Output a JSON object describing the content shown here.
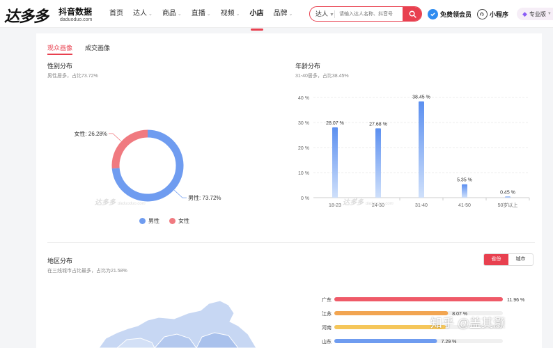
{
  "header": {
    "logo_text": "达多多",
    "logo_subtitle": "抖音数据",
    "logo_domain": "daduoduo.com",
    "nav": [
      {
        "label": "首页",
        "caret": false,
        "active": false
      },
      {
        "label": "达人",
        "caret": true,
        "active": false
      },
      {
        "label": "商品",
        "caret": true,
        "active": false
      },
      {
        "label": "直播",
        "caret": true,
        "active": false
      },
      {
        "label": "视频",
        "caret": true,
        "active": false
      },
      {
        "label": "小店",
        "caret": false,
        "active": true
      },
      {
        "label": "品牌",
        "caret": true,
        "active": false
      }
    ],
    "search": {
      "type_label": "达人",
      "placeholder": "请输入达人名称、抖音号"
    },
    "free_member_label": "免费领会员",
    "mini_program_label": "小程序",
    "pro_label": "专业版",
    "brand_color": "#e8404f"
  },
  "subtabs": {
    "audience": "观众画像",
    "deal": "成交画像"
  },
  "gender": {
    "title": "性别分布",
    "subtitle": "男性居多，占比73.72%",
    "legend_male": "男性",
    "legend_female": "女性"
  },
  "age": {
    "title": "年龄分布",
    "subtitle": "31-40居多，占比38.45%"
  },
  "region": {
    "title": "地区分布",
    "subtitle": "在三线城市占比最多，占比为21.58%",
    "toggle_province": "省份",
    "toggle_city": "城市"
  },
  "watermark": {
    "logo": "达多多",
    "domain": "daduoduo.com"
  },
  "zhihu_watermark": "知乎 @盖其灏",
  "chart_data": [
    {
      "type": "pie",
      "title": "性别分布",
      "categories": [
        "男性",
        "女性"
      ],
      "values": [
        73.72,
        26.28
      ],
      "slice_labels": [
        "男性: 73.72%",
        "女性: 26.28%"
      ],
      "colors": [
        "#6f9cf0",
        "#f07a80"
      ],
      "donut": true,
      "legend": "bottom"
    },
    {
      "type": "bar",
      "title": "年龄分布",
      "categories": [
        "18-23",
        "24-30",
        "31-40",
        "41-50",
        "50岁以上"
      ],
      "values": [
        28.07,
        27.68,
        38.45,
        5.35,
        0.45
      ],
      "data_labels": [
        "28.07 %",
        "27.68 %",
        "38.45 %",
        "5.35 %",
        "0.45 %"
      ],
      "ylim": [
        0,
        40
      ],
      "yticks": [
        0,
        10,
        20,
        30,
        40
      ],
      "ytick_labels": [
        "0 %",
        "10 %",
        "20 %",
        "30 %",
        "40 %"
      ],
      "grid": true,
      "color": "#5b8ff0"
    },
    {
      "type": "bar",
      "orientation": "horizontal",
      "title": "地区分布",
      "categories": [
        "广东",
        "江苏",
        "河南",
        "山东"
      ],
      "values": [
        11.96,
        8.07,
        7.93,
        7.29
      ],
      "data_labels": [
        "11.96 %",
        "8.07 %",
        "",
        "7.29 %"
      ],
      "colors": [
        "#ef5a68",
        "#f2a551",
        "#f5c65a",
        "#6f9cf0"
      ]
    }
  ]
}
